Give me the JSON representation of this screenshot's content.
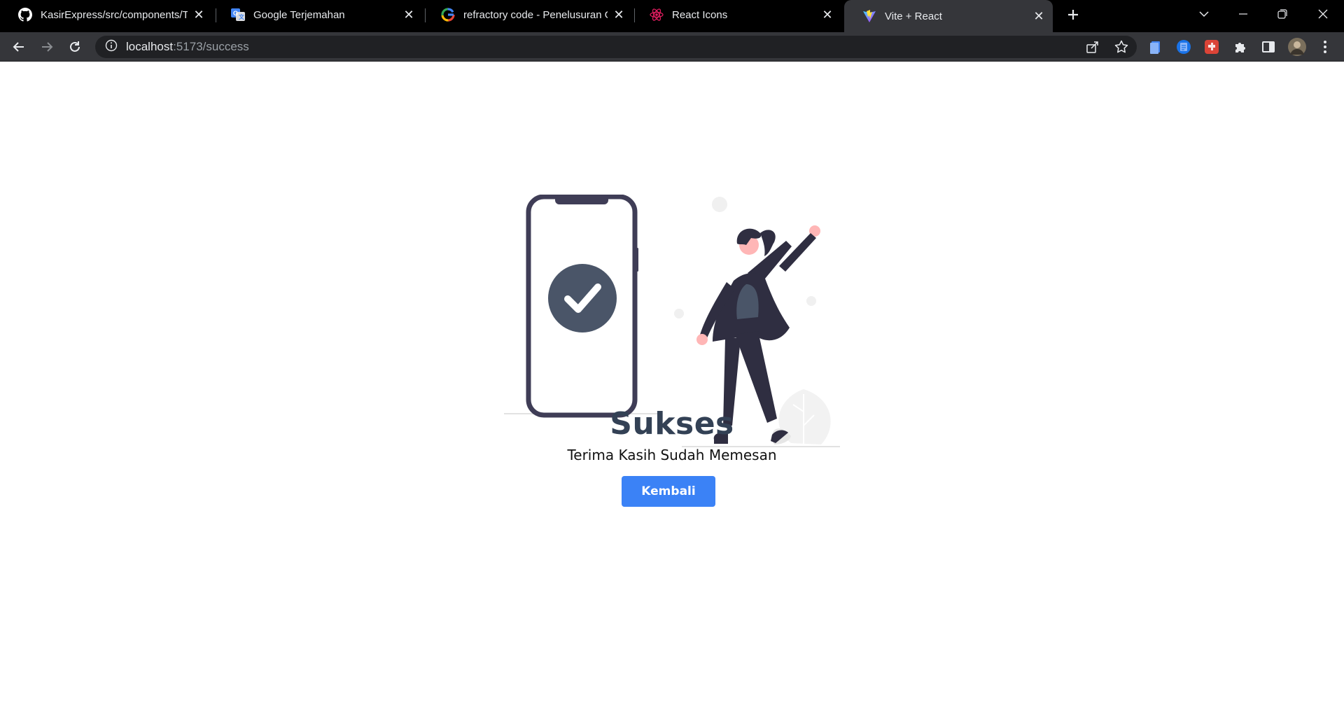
{
  "browser": {
    "tabs": [
      {
        "title": "KasirExpress/src/components/Tot",
        "icon": "github-icon",
        "active": false
      },
      {
        "title": "Google Terjemahan",
        "icon": "google-translate-icon",
        "active": false
      },
      {
        "title": "refractory code - Penelusuran Go",
        "icon": "google-icon",
        "active": false
      },
      {
        "title": "React Icons",
        "icon": "react-icon",
        "active": false
      },
      {
        "title": "Vite + React",
        "icon": "vite-icon",
        "active": true
      }
    ],
    "address": {
      "host": "localhost",
      "path": ":5173/success"
    },
    "colors": {
      "tabstrip": "#000000",
      "toolbar": "#35363a",
      "omnibox": "#202124"
    }
  },
  "page": {
    "title": "Sukses",
    "subtitle": "Terima Kasih Sudah Memesan",
    "button_label": "Kembali",
    "colors": {
      "button": "#3b82f6",
      "title": "#334155",
      "check_circle": "#4a5568",
      "figure": "#2f2e41",
      "skin": "#ffb6b6"
    }
  }
}
